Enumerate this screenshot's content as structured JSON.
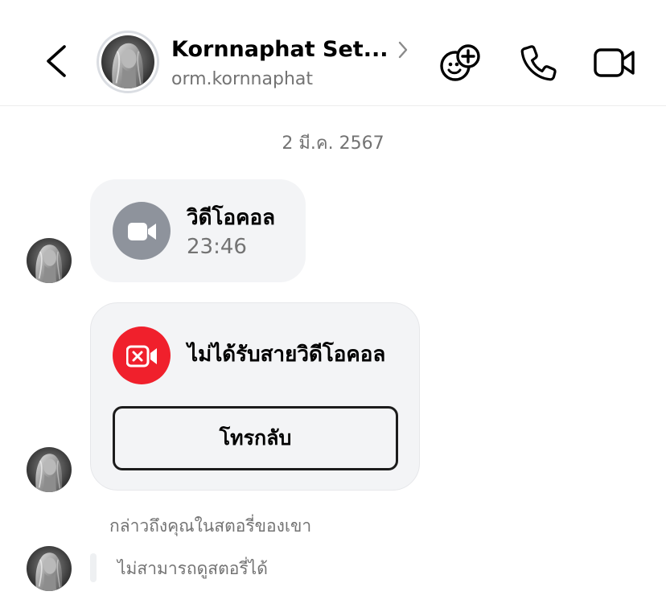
{
  "header": {
    "contact_name": "Kornnaphat Set...",
    "username": "orm.kornnaphat",
    "icons": {
      "back": "chevron-left-icon",
      "chevron": "chevron-right-icon",
      "effects": "effects-icon",
      "call": "phone-icon",
      "video": "video-camera-icon"
    }
  },
  "chat": {
    "date": "2 มี.ค. 2567",
    "video_call": {
      "title": "วิดีโอคอล",
      "duration": "23:46",
      "icon": "video-camera-icon"
    },
    "missed_call": {
      "title": "ไม่ได้รับสายวิดีโอคอล",
      "callback_label": "โทรกลับ",
      "icon": "missed-video-icon"
    },
    "story": {
      "caption": "กล่าวถึงคุณในสตอรี่ของเขา",
      "unavailable": "ไม่สามารถดูสตอรี่ได้"
    }
  },
  "colors": {
    "bubble_bg": "#f3f4f6",
    "missed_red": "#f0202c",
    "call_gray": "#8e939c",
    "secondary_text": "#737373"
  }
}
